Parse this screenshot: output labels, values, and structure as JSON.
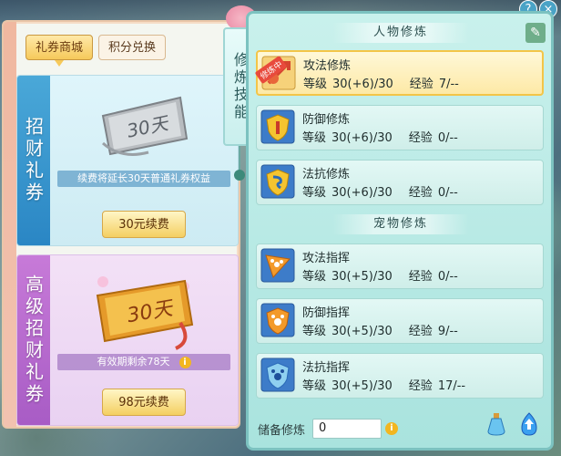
{
  "top_buttons": {
    "help": "?",
    "close": "×"
  },
  "left": {
    "tabs": [
      {
        "label": "礼券商城",
        "active": true
      },
      {
        "label": "积分兑换",
        "active": false
      }
    ],
    "cards": [
      {
        "side_label": "招财礼券",
        "ticket_text": "30天",
        "info": "续费将延长30天普通礼券权益",
        "button": "30元续费",
        "color": "#2a86c4"
      },
      {
        "side_label": "高级招财礼券",
        "ticket_text": "30天",
        "info": "有效期剩余78天",
        "button": "98元续费",
        "color": "#a85cc5"
      }
    ]
  },
  "vertical_label": "修炼技能",
  "right": {
    "sections": [
      {
        "header": "人物修炼",
        "rows": [
          {
            "name": "攻法修炼",
            "level_label": "等级",
            "level": "30(+6)/30",
            "exp_label": "经验",
            "exp": "7/--",
            "active": true,
            "badge": "修炼中",
            "icon": "attack-icon"
          },
          {
            "name": "防御修炼",
            "level_label": "等级",
            "level": "30(+6)/30",
            "exp_label": "经验",
            "exp": "0/--",
            "active": false,
            "icon": "defense-icon"
          },
          {
            "name": "法抗修炼",
            "level_label": "等级",
            "level": "30(+6)/30",
            "exp_label": "经验",
            "exp": "0/--",
            "active": false,
            "icon": "magic-resist-icon"
          }
        ]
      },
      {
        "header": "宠物修炼",
        "rows": [
          {
            "name": "攻法指挥",
            "level_label": "等级",
            "level": "30(+5)/30",
            "exp_label": "经验",
            "exp": "0/--",
            "active": false,
            "icon": "pet-attack-icon"
          },
          {
            "name": "防御指挥",
            "level_label": "等级",
            "level": "30(+5)/30",
            "exp_label": "经验",
            "exp": "9/--",
            "active": false,
            "icon": "pet-defense-icon"
          },
          {
            "name": "法抗指挥",
            "level_label": "等级",
            "level": "30(+5)/30",
            "exp_label": "经验",
            "exp": "17/--",
            "active": false,
            "icon": "pet-resist-icon"
          }
        ]
      }
    ],
    "reserve_label": "储备修炼",
    "reserve_value": "0"
  }
}
